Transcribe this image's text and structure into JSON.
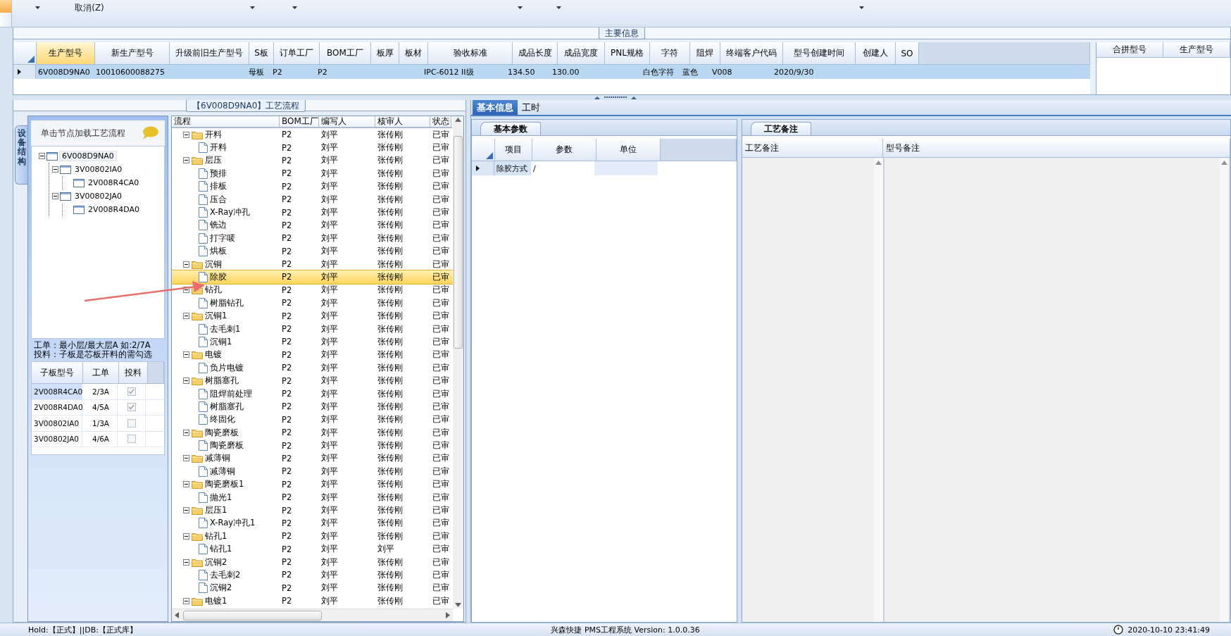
{
  "toolbar": {
    "cancel_label": "取消(Z)"
  },
  "main_info": {
    "title": "主要信息",
    "row_selected": true,
    "columns": [
      {
        "label": "生产型号",
        "selected": true,
        "cell": "6V008D9NA0"
      },
      {
        "label": "新生产型号",
        "selected": false,
        "cell": "10010600088275"
      },
      {
        "label": "升级前旧生产型号",
        "selected": false
      },
      {
        "label": "S板",
        "selected": false,
        "cell": "母板"
      },
      {
        "label": "订单工厂",
        "selected": false,
        "cell": "P2"
      },
      {
        "label": "BOM工厂",
        "selected": false,
        "cell": "P2"
      },
      {
        "label": "板厚",
        "selected": false
      },
      {
        "label": "板材",
        "selected": false
      },
      {
        "label": "验收标准",
        "selected": false,
        "cell": "IPC-6012 II级"
      },
      {
        "label": "成品长度",
        "selected": false,
        "cell": "134.50"
      },
      {
        "label": "成品宽度",
        "selected": false,
        "cell": "130.00"
      },
      {
        "label": "PNL规格",
        "selected": false
      },
      {
        "label": "字符",
        "selected": false,
        "cell": "白色字符"
      },
      {
        "label": "阻焊",
        "selected": false,
        "cell": "蓝色"
      },
      {
        "label": "终端客户代码",
        "selected": false,
        "cell": "V008"
      },
      {
        "label": "型号创建时间",
        "selected": false,
        "cell": "2020/9/30"
      },
      {
        "label": "创建人",
        "selected": false
      },
      {
        "label": "SO",
        "selected": false
      }
    ],
    "merge_columns": [
      "合拼型号",
      "生产型号"
    ]
  },
  "process_panel": {
    "title": "【6V008D9NA0】工艺流程",
    "side_tab": "设备结构",
    "hint": "单击节点加载工艺流程",
    "structure_tree": [
      {
        "label": "6V008D9NA0",
        "expanded": true,
        "children": [
          {
            "label": "3V00802IA0",
            "expanded": true,
            "children": [
              {
                "label": "2V008R4CA0"
              }
            ]
          },
          {
            "label": "3V00802JA0",
            "expanded": true,
            "children": [
              {
                "label": "2V008R4DA0"
              }
            ]
          }
        ]
      }
    ],
    "notes": [
      "工单：最小层/最大层A 如:2/7A",
      "投料：子板是芯板开料的需勾选"
    ],
    "sub_boards": {
      "columns": [
        "子板型号",
        "工单",
        "投料"
      ],
      "rows": [
        {
          "model": "2V008R4CA0",
          "order": "2/3A",
          "checked": true,
          "selected": true
        },
        {
          "model": "2V008R4DA0",
          "order": "4/5A",
          "checked": true,
          "selected": false
        },
        {
          "model": "3V00802IA0",
          "order": "1/3A",
          "checked": false,
          "selected": false
        },
        {
          "model": "3V00802JA0",
          "order": "4/6A",
          "checked": false,
          "selected": false
        }
      ]
    },
    "flow": {
      "columns": [
        "流程",
        "BOM工厂",
        "编写人",
        "核审人",
        "状态"
      ],
      "rows": [
        {
          "name": "开料",
          "bom": "P2",
          "writer": "刘平",
          "reviewer": "张传刚",
          "status": "已审",
          "selected": false,
          "expanded": true,
          "children": [
            {
              "name": "开料",
              "bom": "P2",
              "writer": "刘平",
              "reviewer": "张传刚",
              "status": "已审",
              "selected": false
            }
          ]
        },
        {
          "name": "层压",
          "bom": "P2",
          "writer": "刘平",
          "reviewer": "张传刚",
          "status": "已审",
          "selected": false,
          "expanded": true,
          "children": [
            {
              "name": "预排",
              "bom": "P2",
              "writer": "刘平",
              "reviewer": "张传刚",
              "status": "已审",
              "selected": false
            },
            {
              "name": "排板",
              "bom": "P2",
              "writer": "刘平",
              "reviewer": "张传刚",
              "status": "已审",
              "selected": false
            },
            {
              "name": "压合",
              "bom": "P2",
              "writer": "刘平",
              "reviewer": "张传刚",
              "status": "已审",
              "selected": false
            },
            {
              "name": "X-Ray冲孔",
              "bom": "P2",
              "writer": "刘平",
              "reviewer": "张传刚",
              "status": "已审",
              "selected": false
            },
            {
              "name": "铣边",
              "bom": "P2",
              "writer": "刘平",
              "reviewer": "张传刚",
              "status": "已审",
              "selected": false
            },
            {
              "name": "打字唛",
              "bom": "P2",
              "writer": "刘平",
              "reviewer": "张传刚",
              "status": "已审",
              "selected": false
            },
            {
              "name": "烘板",
              "bom": "P2",
              "writer": "刘平",
              "reviewer": "张传刚",
              "status": "已审",
              "selected": false
            }
          ]
        },
        {
          "name": "沉铜",
          "bom": "P2",
          "writer": "刘平",
          "reviewer": "张传刚",
          "status": "已审",
          "selected": false,
          "expanded": true,
          "children": [
            {
              "name": "除胶",
              "bom": "P2",
              "writer": "刘平",
              "reviewer": "张传刚",
              "status": "已审",
              "selected": true
            }
          ]
        },
        {
          "name": "钻孔",
          "bom": "P2",
          "writer": "刘平",
          "reviewer": "张传刚",
          "status": "已审",
          "selected": false,
          "expanded": true,
          "children": [
            {
              "name": "树脂钻孔",
              "bom": "P2",
              "writer": "刘平",
              "reviewer": "张传刚",
              "status": "已审",
              "selected": false
            }
          ]
        },
        {
          "name": "沉铜1",
          "bom": "P2",
          "writer": "刘平",
          "reviewer": "张传刚",
          "status": "已审",
          "selected": false,
          "expanded": true,
          "children": [
            {
              "name": "去毛刺1",
              "bom": "P2",
              "writer": "刘平",
              "reviewer": "张传刚",
              "status": "已审",
              "selected": false
            },
            {
              "name": "沉铜1",
              "bom": "P2",
              "writer": "刘平",
              "reviewer": "张传刚",
              "status": "已审",
              "selected": false
            }
          ]
        },
        {
          "name": "电镀",
          "bom": "P2",
          "writer": "刘平",
          "reviewer": "张传刚",
          "status": "已审",
          "selected": false,
          "expanded": true,
          "children": [
            {
              "name": "负片电镀",
              "bom": "P2",
              "writer": "刘平",
              "reviewer": "张传刚",
              "status": "已审",
              "selected": false
            }
          ]
        },
        {
          "name": "树脂塞孔",
          "bom": "P2",
          "writer": "刘平",
          "reviewer": "张传刚",
          "status": "已审",
          "selected": false,
          "expanded": true,
          "children": [
            {
              "name": "阻焊前处理",
              "bom": "P2",
              "writer": "刘平",
              "reviewer": "张传刚",
              "status": "已审",
              "selected": false
            },
            {
              "name": "树脂塞孔",
              "bom": "P2",
              "writer": "刘平",
              "reviewer": "张传刚",
              "status": "已审",
              "selected": false
            },
            {
              "name": "终固化",
              "bom": "P2",
              "writer": "刘平",
              "reviewer": "张传刚",
              "status": "已审",
              "selected": false
            }
          ]
        },
        {
          "name": "陶瓷磨板",
          "bom": "P2",
          "writer": "刘平",
          "reviewer": "张传刚",
          "status": "已审",
          "selected": false,
          "expanded": true,
          "children": [
            {
              "name": "陶瓷磨板",
              "bom": "P2",
              "writer": "刘平",
              "reviewer": "张传刚",
              "status": "已审",
              "selected": false
            }
          ]
        },
        {
          "name": "减薄铜",
          "bom": "P2",
          "writer": "刘平",
          "reviewer": "张传刚",
          "status": "已审",
          "selected": false,
          "expanded": true,
          "children": [
            {
              "name": "减薄铜",
              "bom": "P2",
              "writer": "刘平",
              "reviewer": "张传刚",
              "status": "已审",
              "selected": false
            }
          ]
        },
        {
          "name": "陶瓷磨板1",
          "bom": "P2",
          "writer": "刘平",
          "reviewer": "张传刚",
          "status": "已审",
          "selected": false,
          "expanded": true,
          "children": [
            {
              "name": "抛光1",
              "bom": "P2",
              "writer": "刘平",
              "reviewer": "张传刚",
              "status": "已审",
              "selected": false
            }
          ]
        },
        {
          "name": "层压1",
          "bom": "P2",
          "writer": "刘平",
          "reviewer": "张传刚",
          "status": "已审",
          "selected": false,
          "expanded": true,
          "children": [
            {
              "name": "X-Ray冲孔1",
              "bom": "P2",
              "writer": "刘平",
              "reviewer": "张传刚",
              "status": "已审",
              "selected": false
            }
          ]
        },
        {
          "name": "钻孔1",
          "bom": "P2",
          "writer": "刘平",
          "reviewer": "张传刚",
          "status": "已审",
          "selected": false,
          "expanded": true,
          "children": [
            {
              "name": "钻孔1",
              "bom": "P2",
              "writer": "刘平",
              "reviewer": "刘平",
              "status": "已审",
              "selected": false
            }
          ]
        },
        {
          "name": "沉铜2",
          "bom": "P2",
          "writer": "刘平",
          "reviewer": "张传刚",
          "status": "已审",
          "selected": false,
          "expanded": true,
          "children": [
            {
              "name": "去毛刺2",
              "bom": "P2",
              "writer": "刘平",
              "reviewer": "张传刚",
              "status": "已审",
              "selected": false
            },
            {
              "name": "沉铜2",
              "bom": "P2",
              "writer": "刘平",
              "reviewer": "张传刚",
              "status": "已审",
              "selected": false
            }
          ]
        },
        {
          "name": "电镀1",
          "bom": "P2",
          "writer": "刘平",
          "reviewer": "张传刚",
          "status": "已审",
          "selected": false,
          "expanded": true
        }
      ]
    }
  },
  "detail": {
    "tabs": [
      {
        "label": "基本信息",
        "selected": true
      },
      {
        "label": "工时",
        "selected": false
      }
    ],
    "params": {
      "tab": "基本参数",
      "columns": [
        {
          "label": "项目",
          "cell": "除胶方式"
        },
        {
          "label": "参数",
          "cell": "/"
        },
        {
          "label": "单位"
        }
      ]
    },
    "remarks": {
      "tab": "工艺备注",
      "columns": [
        "工艺备注",
        "型号备注"
      ]
    }
  },
  "status_bar": {
    "left": "Hold:【正式】||DB:【正式库】",
    "center": "兴森快捷 PMS工程系统 Version: 1.0.0.36",
    "right": "2020-10-10 23:41:49"
  }
}
